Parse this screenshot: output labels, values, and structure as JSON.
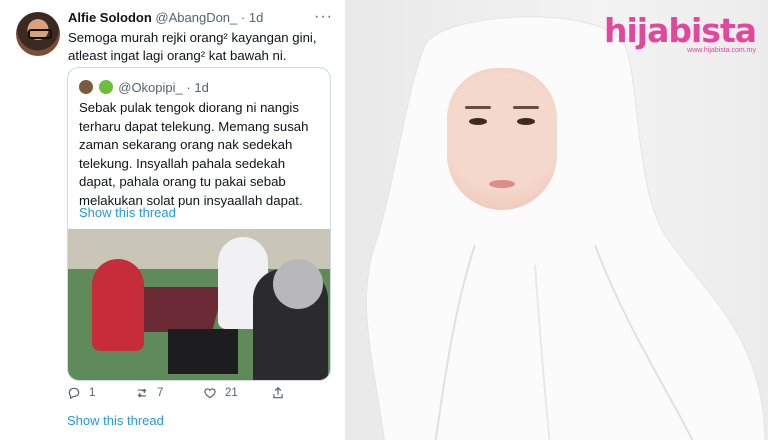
{
  "tweet": {
    "author_name": "Alfie Solodon",
    "handle": "@AbangDon_",
    "separator": "·",
    "time": "1d",
    "more": "···",
    "text": "Semoga murah rejki orang² kayangan gini, atleast ingat lagi orang² kat bawah ni.",
    "quote": {
      "handle": "@Okopipi_",
      "separator": "·",
      "time": "1d",
      "text": "Sebak pulak tengok diorang ni nangis terharu dapat telekung. Memang susah zaman sekarang orang nak sedekah telekung. Insyallah pahala sedekah dapat, pahala orang tu pakai sebab melakukan solat pun insyaallah dapat.",
      "show_thread": "Show this thread"
    },
    "actions": {
      "replies": "1",
      "retweets": "7",
      "likes": "21"
    },
    "show_thread": "Show this thread"
  },
  "photo": {
    "brand_logo": "hijabista",
    "brand_url": "www.hijabista.com.my"
  },
  "colors": {
    "link": "#1d9bf0",
    "muted": "#536471",
    "brand": "#e2479b"
  }
}
